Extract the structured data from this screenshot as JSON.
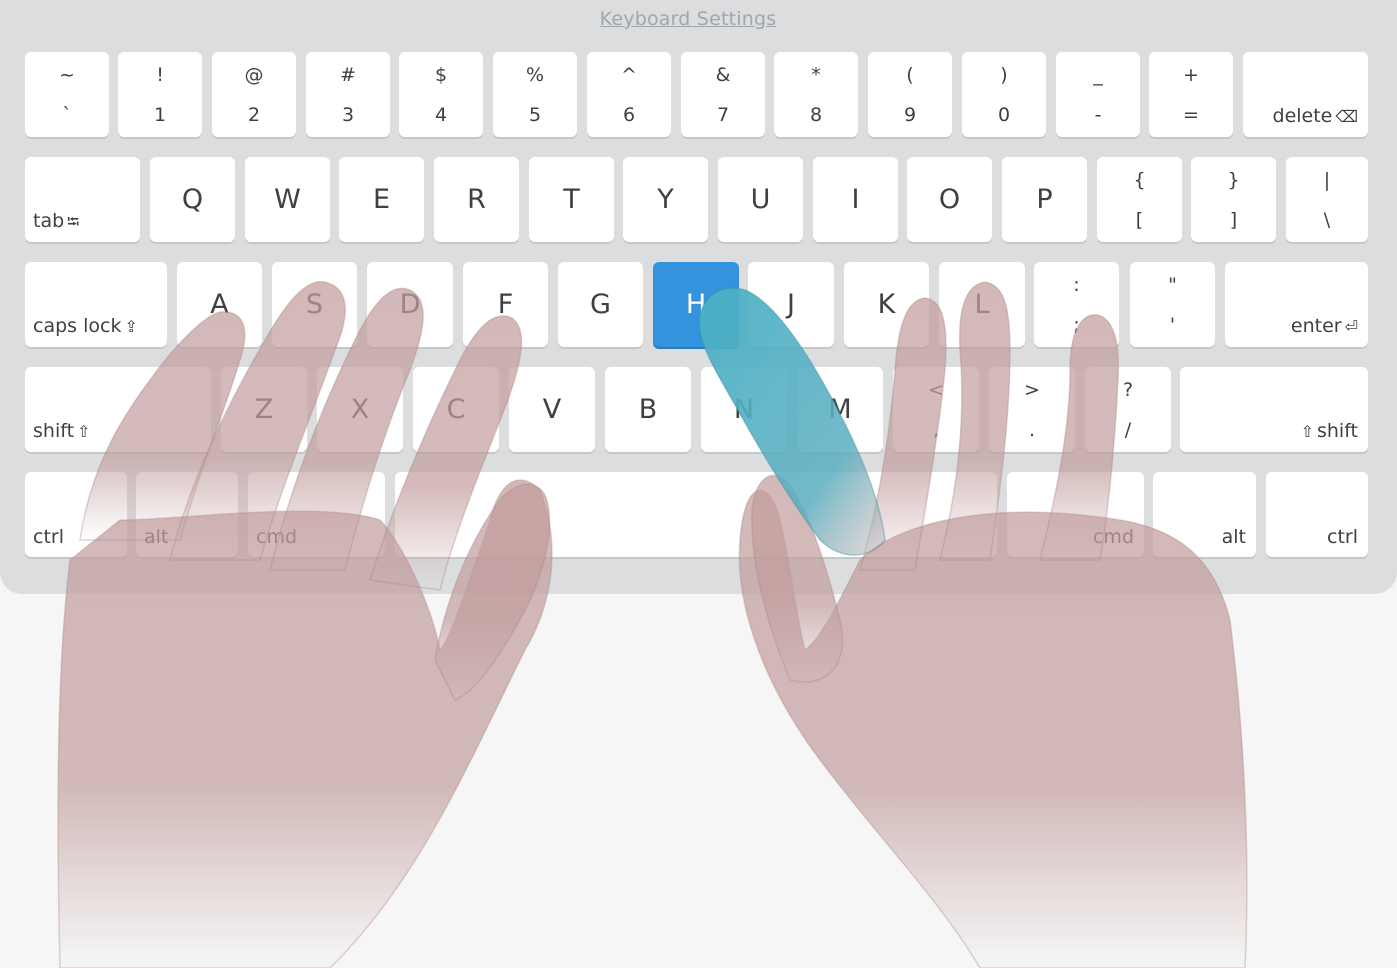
{
  "header": {
    "settings_link": "Keyboard Settings"
  },
  "keyboard": {
    "active_key": "H",
    "active_color": "#3393dc",
    "hand_color": "#c9a9a9",
    "rows": [
      [
        {
          "id": "backtick",
          "top": "~",
          "bottom": "`"
        },
        {
          "id": "1",
          "top": "!",
          "bottom": "1"
        },
        {
          "id": "2",
          "top": "@",
          "bottom": "2"
        },
        {
          "id": "3",
          "top": "#",
          "bottom": "3"
        },
        {
          "id": "4",
          "top": "$",
          "bottom": "4"
        },
        {
          "id": "5",
          "top": "%",
          "bottom": "5"
        },
        {
          "id": "6",
          "top": "^",
          "bottom": "6"
        },
        {
          "id": "7",
          "top": "&",
          "bottom": "7"
        },
        {
          "id": "8",
          "top": "*",
          "bottom": "8"
        },
        {
          "id": "9",
          "top": "(",
          "bottom": "9"
        },
        {
          "id": "0",
          "top": ")",
          "bottom": "0"
        },
        {
          "id": "minus",
          "top": "_",
          "bottom": "-"
        },
        {
          "id": "equals",
          "top": "+",
          "bottom": "="
        },
        {
          "id": "delete",
          "label": "delete",
          "glyph": "⌫",
          "align": "right"
        }
      ],
      [
        {
          "id": "tab",
          "label": "tab",
          "glyph": "⭾",
          "align": "left"
        },
        {
          "id": "q",
          "label": "Q"
        },
        {
          "id": "w",
          "label": "W"
        },
        {
          "id": "e",
          "label": "E"
        },
        {
          "id": "r",
          "label": "R"
        },
        {
          "id": "t",
          "label": "T"
        },
        {
          "id": "y",
          "label": "Y"
        },
        {
          "id": "u",
          "label": "U"
        },
        {
          "id": "i",
          "label": "I"
        },
        {
          "id": "o",
          "label": "O"
        },
        {
          "id": "p",
          "label": "P"
        },
        {
          "id": "lbracket",
          "top": "{",
          "bottom": "["
        },
        {
          "id": "rbracket",
          "top": "}",
          "bottom": "]"
        },
        {
          "id": "backslash",
          "top": "|",
          "bottom": "\\"
        }
      ],
      [
        {
          "id": "capslock",
          "label": "caps lock",
          "glyph": "⇪",
          "align": "left"
        },
        {
          "id": "a",
          "label": "A"
        },
        {
          "id": "s",
          "label": "S"
        },
        {
          "id": "d",
          "label": "D"
        },
        {
          "id": "f",
          "label": "F"
        },
        {
          "id": "g",
          "label": "G"
        },
        {
          "id": "h",
          "label": "H"
        },
        {
          "id": "j",
          "label": "J"
        },
        {
          "id": "k",
          "label": "K"
        },
        {
          "id": "l",
          "label": "L"
        },
        {
          "id": "semicolon",
          "top": ":",
          "bottom": ";"
        },
        {
          "id": "quote",
          "top": "\"",
          "bottom": "'"
        },
        {
          "id": "enter",
          "label": "enter",
          "glyph": "⏎",
          "align": "right"
        }
      ],
      [
        {
          "id": "lshift",
          "label": "shift",
          "glyph": "⇧",
          "align": "left"
        },
        {
          "id": "z",
          "label": "Z"
        },
        {
          "id": "x",
          "label": "X"
        },
        {
          "id": "c",
          "label": "C"
        },
        {
          "id": "v",
          "label": "V"
        },
        {
          "id": "b",
          "label": "B"
        },
        {
          "id": "n",
          "label": "N"
        },
        {
          "id": "m",
          "label": "M"
        },
        {
          "id": "comma",
          "top": "<",
          "bottom": ","
        },
        {
          "id": "period",
          "top": ">",
          "bottom": "."
        },
        {
          "id": "slash",
          "top": "?",
          "bottom": "/"
        },
        {
          "id": "rshift",
          "label": "shift",
          "glyph": "⇧",
          "align": "right",
          "glyph_first": true
        }
      ],
      [
        {
          "id": "lctrl",
          "label": "ctrl",
          "align": "left"
        },
        {
          "id": "lalt",
          "label": "alt",
          "align": "left"
        },
        {
          "id": "lcmd",
          "label": "cmd",
          "align": "left"
        },
        {
          "id": "space",
          "label": ""
        },
        {
          "id": "rcmd",
          "label": "cmd",
          "align": "right"
        },
        {
          "id": "ralt",
          "label": "alt",
          "align": "right"
        },
        {
          "id": "rctrl",
          "label": "ctrl",
          "align": "right"
        }
      ]
    ]
  }
}
